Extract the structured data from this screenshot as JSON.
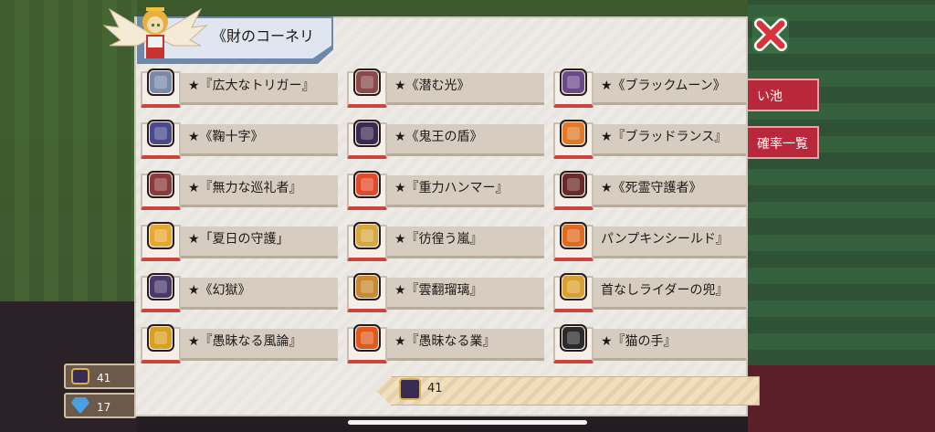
{
  "header": {
    "title": "《財のコーネリ"
  },
  "items": [
    {
      "label": "★『広大なトリガー』",
      "icon": "trigger-icon"
    },
    {
      "label": "★《潜む光》",
      "icon": "blade-icon"
    },
    {
      "label": "★《ブラックムーン》",
      "icon": "black-moon-icon"
    },
    {
      "label": "★《鞠十字》",
      "icon": "cross-shield-icon"
    },
    {
      "label": "★《鬼王の盾》",
      "icon": "demon-shield-icon"
    },
    {
      "label": "★『ブラッドランス』",
      "icon": "blood-lance-icon"
    },
    {
      "label": "★『無力な巡礼者』",
      "icon": "pilgrim-helm-icon"
    },
    {
      "label": "★『重力ハンマー』",
      "icon": "gravity-hammer-icon"
    },
    {
      "label": "★《死霊守護者》",
      "icon": "necro-glove-icon"
    },
    {
      "label": "★「夏日の守護」",
      "icon": "summer-fan-icon"
    },
    {
      "label": "★『彷徨う嵐』",
      "icon": "storm-ring-icon"
    },
    {
      "label": "パンプキンシールド』",
      "icon": "pumpkin-shield-icon"
    },
    {
      "label": "★《幻獄》",
      "icon": "phantom-mace-icon"
    },
    {
      "label": "★『雲翻瑠璃』",
      "icon": "cloud-amulet-icon"
    },
    {
      "label": "首なしライダーの兜』",
      "icon": "headless-helm-icon"
    },
    {
      "label": "★『愚昧なる風論』",
      "icon": "gold-ring-icon"
    },
    {
      "label": "★『愚昧なる業』",
      "icon": "flame-staff-icon"
    },
    {
      "label": "★『猫の手』",
      "icon": "cat-paw-icon"
    }
  ],
  "side_tabs": {
    "tab1": "い池",
    "tab2": "確率一覧"
  },
  "currency": {
    "gem_box_count": "41",
    "diamond_count": "17"
  },
  "footer": {
    "count": "41"
  },
  "colors": {
    "accent": "#c9463f",
    "panel": "#eeebe6",
    "header_blue": "#6d88a9"
  }
}
